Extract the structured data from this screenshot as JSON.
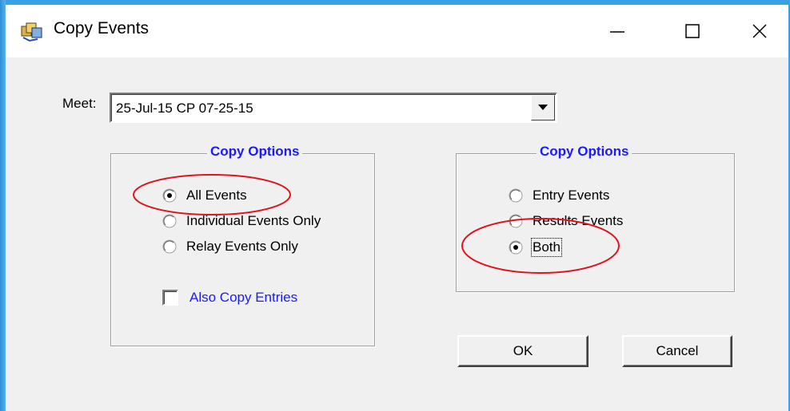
{
  "window": {
    "title": "Copy Events",
    "app_icon": "app-icon",
    "controls": {
      "minimize_glyph": "—",
      "maximize_glyph": "☐",
      "close_glyph": "✕"
    }
  },
  "meet": {
    "label": "Meet:",
    "selected_value": "25-Jul-15 CP 07-25-15",
    "dropdown_icon": "chevron-down-icon"
  },
  "copy_options_left": {
    "title": "Copy Options",
    "radios": [
      {
        "label": "All Events",
        "checked": true
      },
      {
        "label": "Individual Events Only",
        "checked": false
      },
      {
        "label": "Relay Events Only",
        "checked": false
      }
    ],
    "checkbox": {
      "label": "Also Copy Entries",
      "checked": false
    }
  },
  "copy_options_right": {
    "title": "Copy Options",
    "radios": [
      {
        "label": "Entry Events",
        "checked": false
      },
      {
        "label": "Results Events",
        "checked": false
      },
      {
        "label": "Both",
        "checked": true
      }
    ]
  },
  "buttons": {
    "ok": "OK",
    "cancel": "Cancel"
  },
  "colors": {
    "group_title": "#1a1aff",
    "annotation_ellipse": "#e0141e",
    "window_border": "#3aa0e6"
  }
}
